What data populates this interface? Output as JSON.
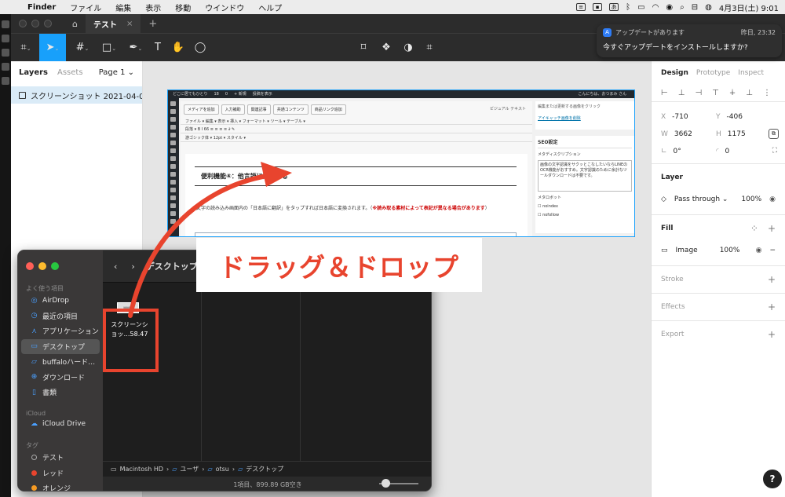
{
  "menubar": {
    "app": "Finder",
    "items": [
      "ファイル",
      "編集",
      "表示",
      "移動",
      "ウインドウ",
      "ヘルプ"
    ],
    "clock": "4月3日(土)  9:01",
    "ime": "あ"
  },
  "figma": {
    "tab_title": "テスト",
    "layers_tab": "Layers",
    "assets_tab": "Assets",
    "page_selector": "Page 1",
    "layer_name": "スクリーンショット 2021-04-03 8....",
    "design_tabs": [
      "Design",
      "Prototype",
      "Inspect"
    ],
    "x_label": "X",
    "x_value": "-710",
    "y_label": "Y",
    "y_value": "-406",
    "w_label": "W",
    "w_value": "3662",
    "h_label": "H",
    "h_value": "1175",
    "rotation": "0°",
    "radius": "0",
    "layer_section": "Layer",
    "blend_mode": "Pass through",
    "layer_opacity": "100%",
    "fill_section": "Fill",
    "fill_type": "Image",
    "fill_opacity": "100%",
    "stroke_section": "Stroke",
    "effects_section": "Effects",
    "export_section": "Export",
    "help": "?"
  },
  "notification": {
    "app": "アップデートがあります",
    "time": "昨日, 23:32",
    "message": "今すぐアップデートをインストールしますか?"
  },
  "screenshot": {
    "site_name": "どこに居てもひとり",
    "comments": "18",
    "zero": "0",
    "new": "+ 新規",
    "view_post": "投稿を表示",
    "greeting": "こんにちは、おつまみ さん",
    "buttons": [
      "メディアを追加",
      "入力補助",
      "関連記事",
      "共通コンテンツ",
      "商品リンク追加"
    ],
    "view_tabs": "ビジュアル  テキスト",
    "menu_row": "ファイル ▾  編集 ▾  表示 ▾  挿入 ▾  フォーマット ▾  ツール ▾  テーブル ▾",
    "format_row": "段落 ▾   B  I  66  ≡  ≡  ≡  ≡  ∂  ✎",
    "font_row": "游ゴシック体 ▾   12pt ▾   スタイル ▾",
    "heading": "便利機能④：他言語に翻訳する",
    "paragraph_plain": "文字の読み込み画面内の「日本語に翻訳」をタップすれば日本語に変換されます。（",
    "paragraph_bold": "※読み取る素材によって表記が異なる場合があります",
    "paragraph_end": "）",
    "side_top": "編集または更新する画像をクリック",
    "side_link": "アイキャッチ画像を削除",
    "seo_title": "SEO設定",
    "meta_label": "メタディスクリプション",
    "meta_text": "画像の文字認識をサクッとこなしたいならLINEのOCR機能がおすすめ。文字認識のために余計なツールダウンロードは不要です。",
    "robots": "メタロボット",
    "noindex": "noindex",
    "nofollow": "nofollow"
  },
  "finder": {
    "title": "デスクトップ",
    "favorites_header": "よく使う項目",
    "favorites": [
      {
        "icon": "airdrop-icon",
        "label": "AirDrop"
      },
      {
        "icon": "clock-icon",
        "label": "最近の項目"
      },
      {
        "icon": "applications-icon",
        "label": "アプリケーション"
      },
      {
        "icon": "desktop-icon",
        "label": "デスクトップ"
      },
      {
        "icon": "folder-icon",
        "label": "buffaloハード…"
      },
      {
        "icon": "download-icon",
        "label": "ダウンロード"
      },
      {
        "icon": "document-icon",
        "label": "書類"
      }
    ],
    "icloud_header": "iCloud",
    "icloud_drive": "iCloud Drive",
    "tags_header": "タグ",
    "tags": [
      {
        "label": "テスト",
        "color": "#3a3838"
      },
      {
        "label": "レッド",
        "color": "#e8442e"
      },
      {
        "label": "オレンジ",
        "color": "#f59a23"
      }
    ],
    "file_line1": "スクリーンシ",
    "file_line2": "ョッ…58.47",
    "path": [
      "Macintosh HD",
      "ユーザ",
      "otsu",
      "デスクトップ"
    ],
    "status": "1項目、899.89 GB空き"
  },
  "annotation": {
    "text": "ドラッグ＆ドロップ",
    "color": "#e8442e"
  }
}
